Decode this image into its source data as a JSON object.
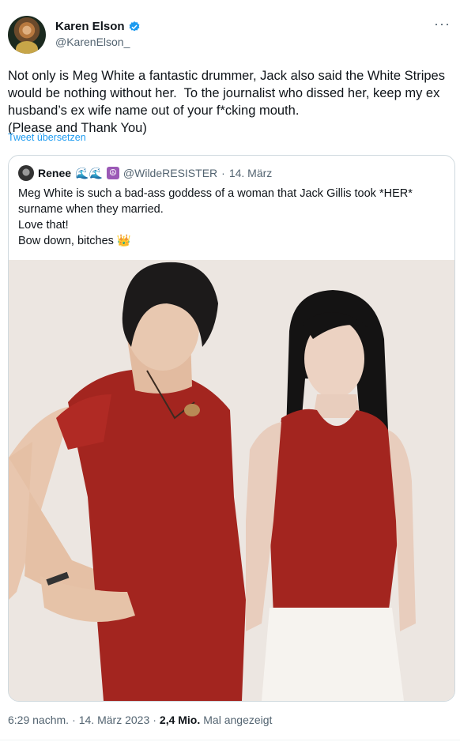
{
  "author": {
    "name": "Karen Elson",
    "handle": "@KarenElson_",
    "verified_icon": "verified-badge-icon"
  },
  "more_label": "···",
  "tweet": {
    "text": "Not only is Meg White a fantastic drummer, Jack also said the White Stripes would be nothing without her.  To the journalist who dissed her, keep my ex husband’s ex wife name out of your f*cking mouth.\n(Please and Thank You)",
    "translate_label": "Tweet übersetzen"
  },
  "quote": {
    "name": "Renee",
    "emojis": "🌊🌊",
    "peace": "☮",
    "handle": "@WildeRESISTER",
    "separator": "·",
    "date": "14. März",
    "text": "Meg White is such a bad-ass goddess of a woman that Jack Gillis took *HER* surname when they married.\nLove that!\nBow down, bitches 👑"
  },
  "meta": {
    "time": "6:29 nachm.",
    "sep1": "·",
    "date": "14. März 2023",
    "sep2": "·",
    "views": "2,4 Mio.",
    "views_label": "Mal angezeigt"
  },
  "colors": {
    "accent": "#1d9bf0",
    "shirt_red": "#a3251f"
  }
}
